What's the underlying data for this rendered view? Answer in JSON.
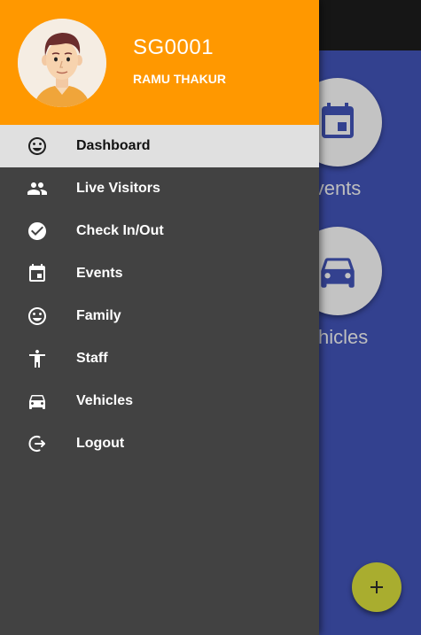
{
  "header": {
    "user_id": "SG0001",
    "user_name": "RAMU THAKUR"
  },
  "menu": {
    "items": [
      {
        "label": "Dashboard",
        "icon": "smiley-icon",
        "active": true
      },
      {
        "label": "Live Visitors",
        "icon": "people-icon"
      },
      {
        "label": "Check In/Out",
        "icon": "check-circle-icon"
      },
      {
        "label": "Events",
        "icon": "calendar-icon"
      },
      {
        "label": "Family",
        "icon": "smiley-icon"
      },
      {
        "label": "Staff",
        "icon": "person-icon"
      },
      {
        "label": "Vehicles",
        "icon": "car-icon"
      },
      {
        "label": "Logout",
        "icon": "logout-icon"
      }
    ]
  },
  "background": {
    "tiles": [
      {
        "label": "vents",
        "icon": "calendar-icon"
      },
      {
        "label": "ehicles",
        "icon": "car-icon"
      }
    ],
    "fab_icon": "plus-icon"
  },
  "colors": {
    "header": "#ff9800",
    "drawer": "#424242",
    "active_item": "#e0e0e0",
    "app_main": "#33418f",
    "fab": "#a9ad2f"
  }
}
